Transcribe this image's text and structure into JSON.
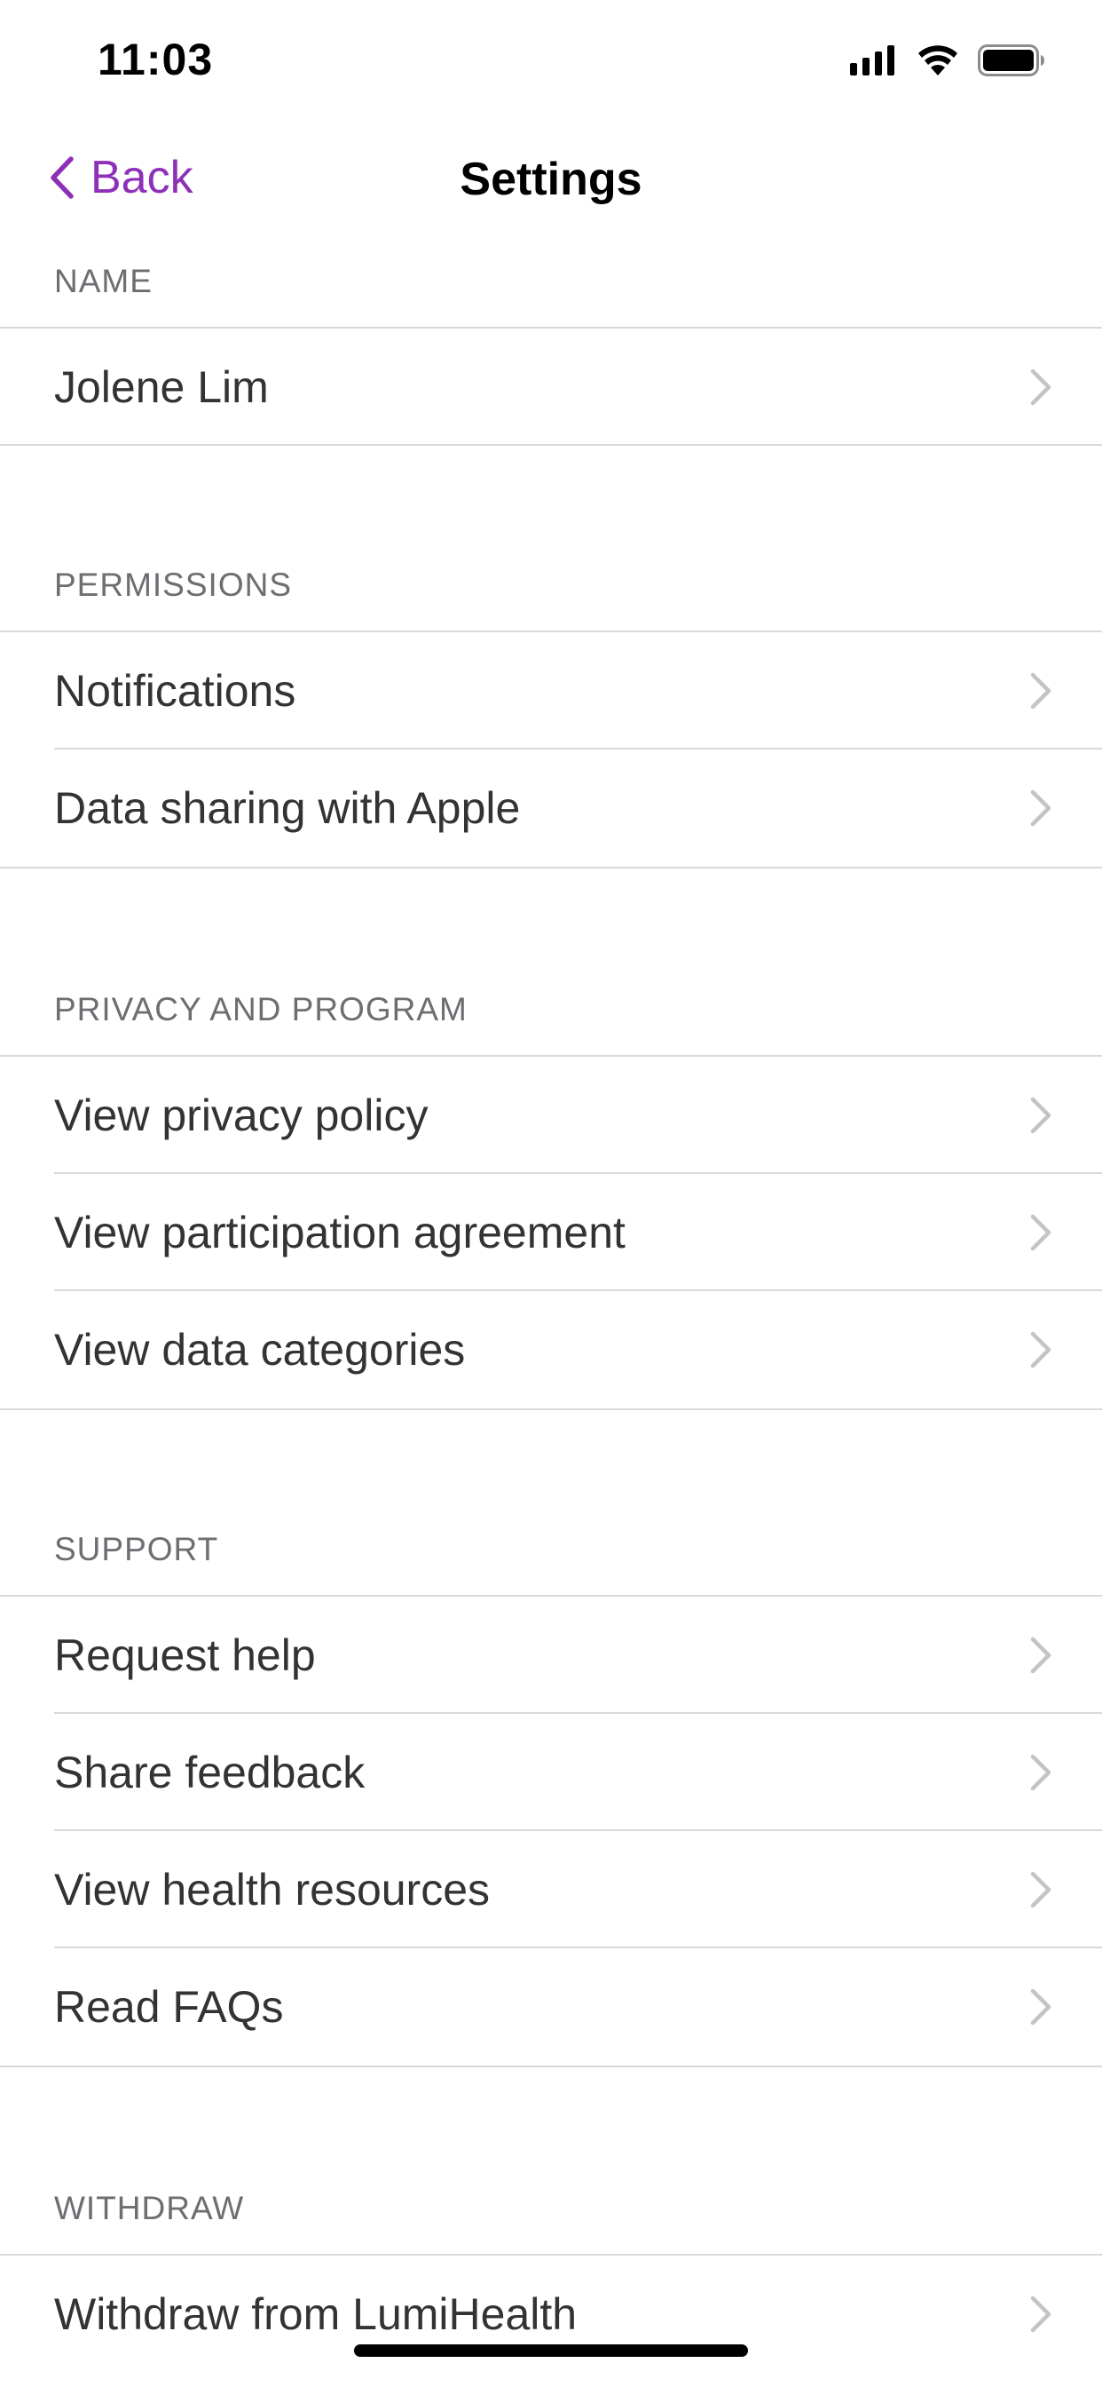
{
  "status_bar": {
    "time": "11:03",
    "icons": [
      "cellular-signal-icon",
      "wifi-icon",
      "battery-icon"
    ]
  },
  "nav": {
    "back_label": "Back",
    "title": "Settings",
    "accent_color": "#8e2fb8"
  },
  "sections": [
    {
      "header": "NAME",
      "rows": [
        {
          "label": "Jolene Lim"
        }
      ]
    },
    {
      "header": "PERMISSIONS",
      "rows": [
        {
          "label": "Notifications"
        },
        {
          "label": "Data sharing with Apple"
        }
      ]
    },
    {
      "header": "PRIVACY AND PROGRAM",
      "rows": [
        {
          "label": "View privacy policy"
        },
        {
          "label": "View participation agreement"
        },
        {
          "label": "View data categories"
        }
      ]
    },
    {
      "header": "SUPPORT",
      "rows": [
        {
          "label": "Request help"
        },
        {
          "label": "Share feedback"
        },
        {
          "label": "View health resources"
        },
        {
          "label": "Read FAQs"
        }
      ]
    },
    {
      "header": "WITHDRAW",
      "rows": [
        {
          "label": "Withdraw from LumiHealth"
        }
      ]
    }
  ]
}
